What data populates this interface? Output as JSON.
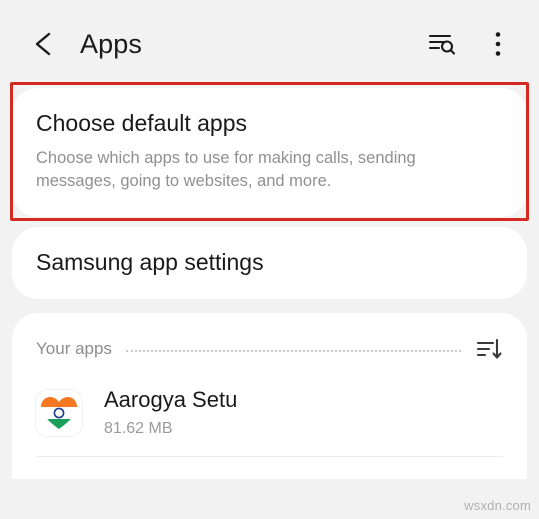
{
  "appbar": {
    "title": "Apps",
    "back_icon": "chevron-left-icon",
    "search_icon": "search-list-icon",
    "more_icon": "more-vertical-icon"
  },
  "cards": {
    "default_apps": {
      "title": "Choose default apps",
      "subtitle": "Choose which apps to use for making calls, sending messages, going to websites, and more.",
      "highlight_color": "#d32b20"
    },
    "samsung_app_settings": {
      "title": "Samsung app settings"
    }
  },
  "your_apps": {
    "header_label": "Your apps",
    "sort_icon": "sort-descending-icon",
    "items": [
      {
        "name": "Aarogya Setu",
        "size": "81.62 MB",
        "icon": "heart-app-icon"
      }
    ]
  },
  "watermark": {
    "text": "wsxdn.com"
  }
}
